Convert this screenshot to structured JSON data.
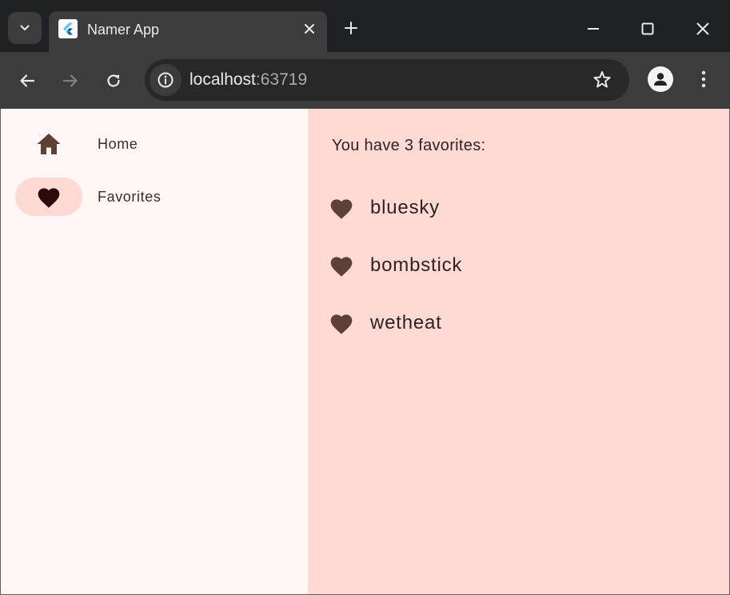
{
  "browser": {
    "tab": {
      "title": "Namer App",
      "favicon": "flutter-logo-icon"
    },
    "address_bar": {
      "host": "localhost",
      "port": ":63719"
    },
    "icons": {
      "tab_search": "chevron-down-icon",
      "close_tab": "close-icon",
      "new_tab": "plus-icon",
      "minimize": "minimize-icon",
      "maximize": "maximize-icon",
      "close_window": "close-icon",
      "back": "back-arrow-icon",
      "forward": "forward-arrow-icon",
      "reload": "reload-icon",
      "site_info": "info-icon",
      "bookmark": "star-icon",
      "profile": "person-icon",
      "menu": "kebab-menu-icon"
    }
  },
  "app": {
    "nav": {
      "items": [
        {
          "label": "Home",
          "icon": "home-icon",
          "selected": false
        },
        {
          "label": "Favorites",
          "icon": "heart-icon",
          "selected": true
        }
      ]
    },
    "favorites": {
      "heading": "You have 3 favorites:",
      "items": [
        "bluesky",
        "bombstick",
        "wetheat"
      ]
    }
  },
  "colors": {
    "rail_bg": "#fff7f5",
    "content_bg": "#ffdad4",
    "indicator_bg": "#ffdad4",
    "icon_brown": "#5d4037",
    "icon_dark": "#2b0a0a",
    "chrome_dark": "#202124",
    "chrome_toolbar": "#3c3c3c"
  }
}
